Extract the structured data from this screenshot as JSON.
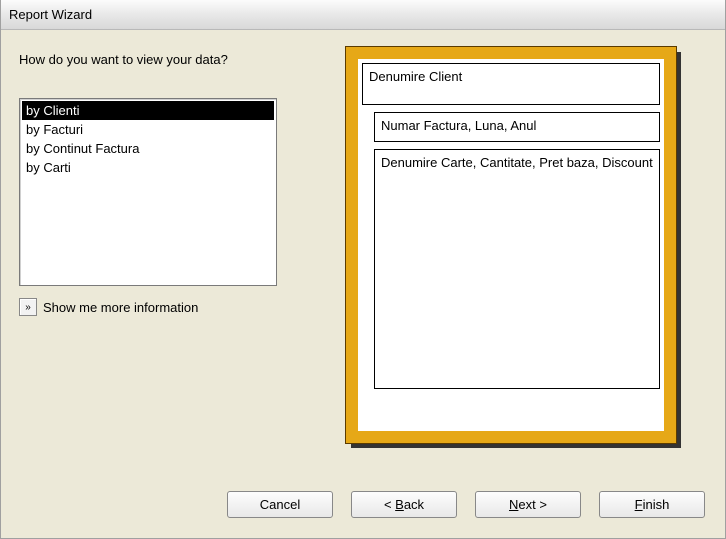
{
  "title": "Report Wizard",
  "prompt": "How do you want to view your data?",
  "list": {
    "items": [
      {
        "label": "by Clienti",
        "selected": true
      },
      {
        "label": "by Facturi",
        "selected": false
      },
      {
        "label": "by Continut Factura",
        "selected": false
      },
      {
        "label": "by Carti",
        "selected": false
      }
    ]
  },
  "showmore": {
    "icon": "»",
    "label": "Show me more information"
  },
  "preview": {
    "level1": "Denumire Client",
    "level2": "Numar Factura, Luna, Anul",
    "level3": "Denumire Carte, Cantitate, Pret baza, Discount"
  },
  "buttons": {
    "cancel": "Cancel",
    "back_prefix": "< ",
    "back_accel": "B",
    "back_rest": "ack",
    "next_accel": "N",
    "next_rest": "ext >",
    "finish_accel": "F",
    "finish_rest": "inish"
  }
}
